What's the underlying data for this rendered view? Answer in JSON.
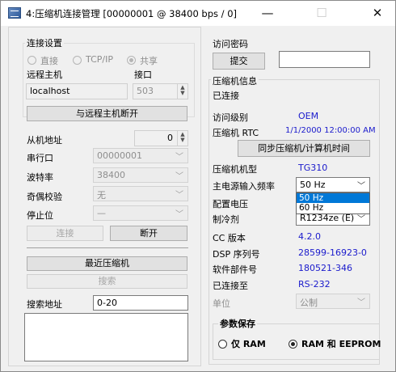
{
  "window": {
    "title": "4:压缩机连接管理 [00000001 @ 38400 bps / 0]",
    "minimize_glyph": "—",
    "maximize_glyph": "☐",
    "close_glyph": "✕"
  },
  "left": {
    "connection_settings": {
      "title": "连接设置",
      "radio_direct": "直接",
      "radio_tcpip": "TCP/IP",
      "radio_shared": "共享",
      "selected": "共享",
      "remote_host_label": "远程主机",
      "port_label": "接口",
      "remote_host_value": "localhost",
      "port_value": "503",
      "disconnect_remote_button": "与远程主机断开"
    },
    "slave_address_label": "从机地址",
    "slave_address_value": "0",
    "serial_port_label": "串行口",
    "serial_port_value": "00000001",
    "baud_rate_label": "波特率",
    "baud_rate_value": "38400",
    "parity_label": "奇偶校验",
    "parity_value": "无",
    "stop_bits_label": "停止位",
    "stop_bits_value": "—",
    "connect_button": "连接",
    "disconnect_button": "断开",
    "recent_compressor_button": "最近压缩机",
    "search_button": "搜索",
    "search_address_label": "搜索地址",
    "search_address_value": "0-20",
    "results_text": ""
  },
  "right": {
    "password": {
      "title": "访问密码",
      "submit_button": "提交",
      "password_value": ""
    },
    "info": {
      "title": "压缩机信息",
      "status": "已连接",
      "access_level_label": "访问级别",
      "access_level_value": "OEM",
      "rtc_label": "压缩机 RTC",
      "rtc_value": "1/1/2000 12:00:00 AM",
      "sync_button": "同步压缩机/计算机时间",
      "model_label": "压缩机机型",
      "model_value": "TG310",
      "mains_freq_label": "主电源输入频率",
      "mains_freq_value": "50 Hz",
      "mains_freq_options": [
        "50 Hz",
        "60 Hz"
      ],
      "voltage_label": "配置电压",
      "refrigerant_label": "制冷剂",
      "refrigerant_value": "R1234ze (E)",
      "cc_version_label": "CC 版本",
      "cc_version_value": "4.2.0",
      "dsp_serial_label": "DSP 序列号",
      "dsp_serial_value": "28599-16923-0",
      "software_label": "软件部件号",
      "software_value": "180521-346",
      "connected_to_label": "已连接至",
      "connected_to_value": "RS-232",
      "units_label": "单位",
      "units_value": "公制"
    },
    "save_params": {
      "title": "参数保存",
      "ram_only": "仅 RAM",
      "ram_eeprom": "RAM 和 EEPROM",
      "selected": "RAM 和 EEPROM"
    }
  }
}
